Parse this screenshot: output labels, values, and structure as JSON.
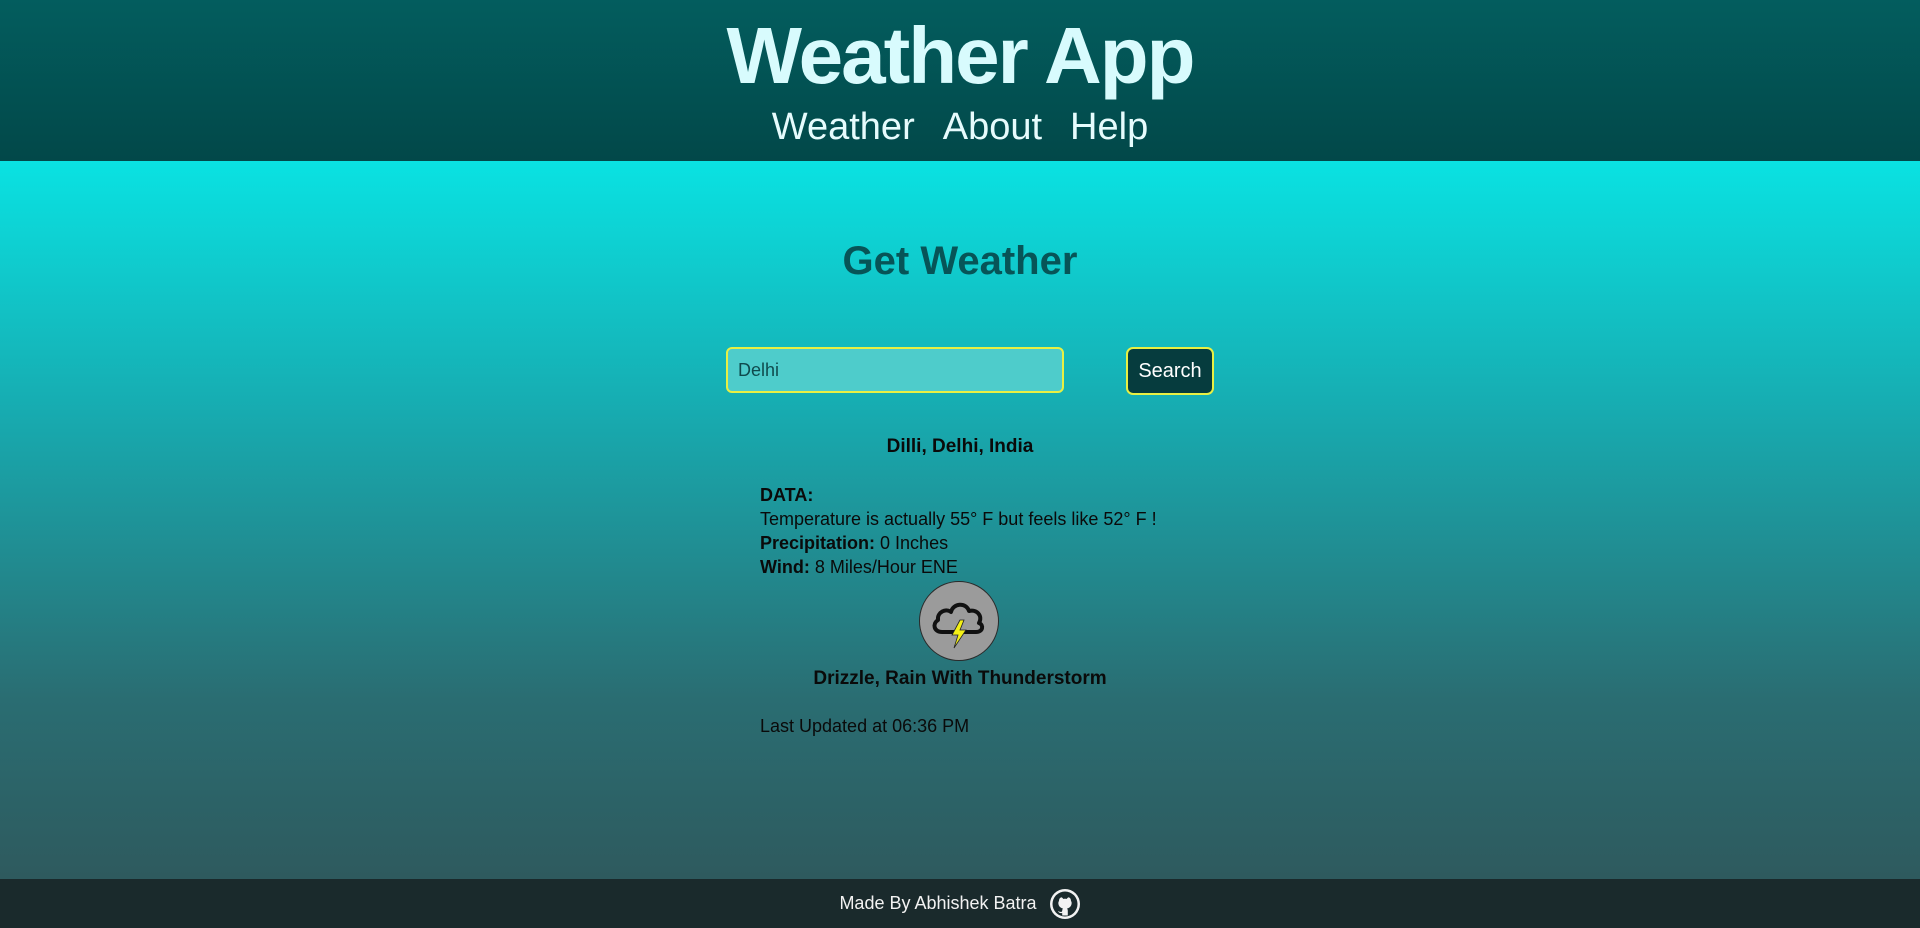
{
  "header": {
    "title": "Weather App",
    "nav": [
      "Weather",
      "About",
      "Help"
    ]
  },
  "main": {
    "heading": "Get Weather",
    "search": {
      "value": "Delhi",
      "button_label": "Search"
    },
    "result": {
      "location": "Dilli, Delhi, India",
      "data_label": "DATA:",
      "temperature_text": "Temperature is actually 55° F but feels like 52° F !",
      "precipitation_label": "Precipitation:",
      "precipitation_value": "0 Inches",
      "wind_label": "Wind:",
      "wind_value": "8 Miles/Hour ENE",
      "icon": "cloud-lightning-icon",
      "condition": "Drizzle, Rain With Thunderstorm",
      "updated": "Last Updated at 06:36 PM"
    }
  },
  "footer": {
    "credit": "Made By Abhishek Batra",
    "icon": "github-icon"
  },
  "colors": {
    "header_bg": "#035d5e",
    "accent_border": "#e8f043",
    "button_bg": "#063c3e",
    "heading_color": "#075457",
    "footer_bg": "#1a2a2c"
  }
}
